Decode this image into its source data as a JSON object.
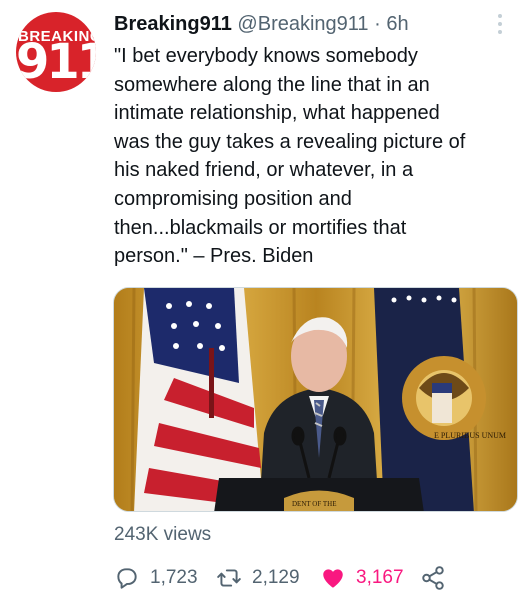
{
  "account": {
    "avatar_top_text": "BREAKING",
    "avatar_main_text": "911",
    "display_name": "Breaking911",
    "handle": "@Breaking911",
    "separator": "·",
    "time": "6h"
  },
  "tweet": {
    "lines": [
      "\"I bet everybody knows somebody",
      "somewhere along the line that in an",
      "intimate relationship, what happened",
      "was the guy takes a revealing picture of",
      "his naked friend, or whatever, in a",
      "compromising position and",
      "then...blackmails or mortifies that",
      "person.\" – Pres. Biden"
    ]
  },
  "media": {
    "seal_text": "E PLURIBUS UNUM",
    "podium_text": "DENT OF THE"
  },
  "stats": {
    "views": "243K views"
  },
  "actions": {
    "reply_count": "1,723",
    "retweet_count": "2,129",
    "like_count": "3,167"
  },
  "icons": [
    "reply-icon",
    "retweet-icon",
    "heart-icon",
    "share-icon",
    "more-icon"
  ],
  "colors": {
    "like": "#f91880",
    "secondary_text": "#536471",
    "avatar_red": "#d8232a"
  }
}
